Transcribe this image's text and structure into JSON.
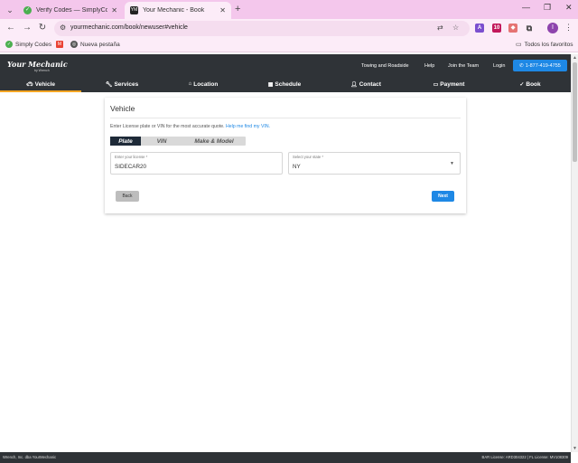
{
  "browser": {
    "tabs": [
      {
        "title": "Verify Codes — SimplyCodes",
        "favicon": "simplycodes-favicon"
      },
      {
        "title": "Your Mechanic - Book",
        "favicon": "yourmechanic-favicon"
      }
    ],
    "url": "yourmechanic.com/book/newuser#vehicle",
    "bookmarks": [
      {
        "label": "Simply Codes"
      },
      {
        "label": ""
      },
      {
        "label": "Nueva pestaña"
      }
    ],
    "all_bookmarks_label": "Todos los favoritos",
    "profile_initial": "I",
    "extension_badge": "10"
  },
  "header": {
    "logo": "Your Mechanic",
    "logo_sub": "by Wrench",
    "links": [
      "Towing and Roadside",
      "Help",
      "Join the Team",
      "Login"
    ],
    "phone": "1-877-419-4755",
    "steps": [
      {
        "label": "Vehicle",
        "icon": "car-icon",
        "active": true
      },
      {
        "label": "Services",
        "icon": "wrench-icon",
        "active": false
      },
      {
        "label": "Location",
        "icon": "home-icon",
        "active": false
      },
      {
        "label": "Schedule",
        "icon": "calendar-icon",
        "active": false
      },
      {
        "label": "Contact",
        "icon": "user-icon",
        "active": false
      },
      {
        "label": "Payment",
        "icon": "card-icon",
        "active": false
      },
      {
        "label": "Book",
        "icon": "check-icon",
        "active": false
      }
    ]
  },
  "card": {
    "title": "Vehicle",
    "description": "Enter License plate or VIN for the most accurate quote.",
    "help_link": "Help me find my VIN.",
    "toggle_options": [
      "Plate",
      "VIN",
      "Make & Model"
    ],
    "toggle_selected": "Plate",
    "license_field": {
      "label": "Enter your license *",
      "value": "SIDECAR20"
    },
    "state_field": {
      "label": "Select your state *",
      "value": "NY"
    },
    "back_label": "Back",
    "next_label": "Next"
  },
  "footer": {
    "left": "Wrench, Inc. dba YourMechanic",
    "right": "BAR License: ARD304322 | FL License: MV108309"
  },
  "colors": {
    "accent_blue": "#1e88e5",
    "header_dark": "#2f3337",
    "active_step_underline": "#f5a623",
    "toggle_active": "#1e2a38"
  }
}
